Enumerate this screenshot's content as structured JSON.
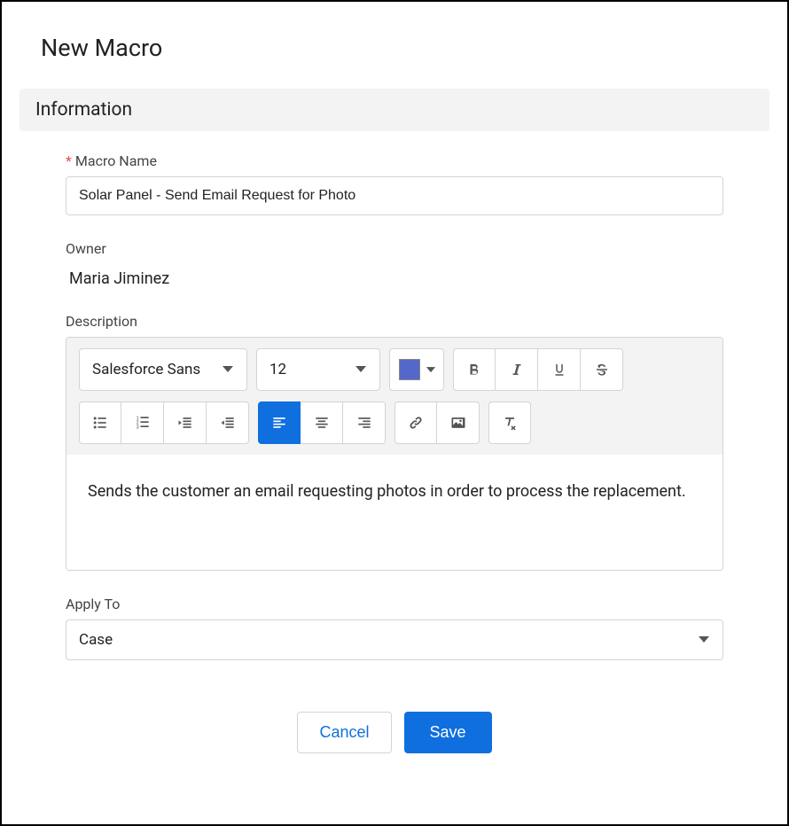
{
  "page": {
    "title": "New Macro"
  },
  "section": {
    "information_label": "Information"
  },
  "fields": {
    "macro_name": {
      "label": "Macro Name",
      "value": "Solar Panel - Send Email Request for Photo"
    },
    "owner": {
      "label": "Owner",
      "value": "Maria Jiminez"
    },
    "description": {
      "label": "Description",
      "value": "Sends the customer an email requesting photos in order to process the replacement."
    },
    "apply_to": {
      "label": "Apply To",
      "value": "Case"
    }
  },
  "editor": {
    "font_family": "Salesforce Sans",
    "font_size": "12",
    "text_color": "#5468c9"
  },
  "buttons": {
    "cancel": "Cancel",
    "save": "Save"
  }
}
